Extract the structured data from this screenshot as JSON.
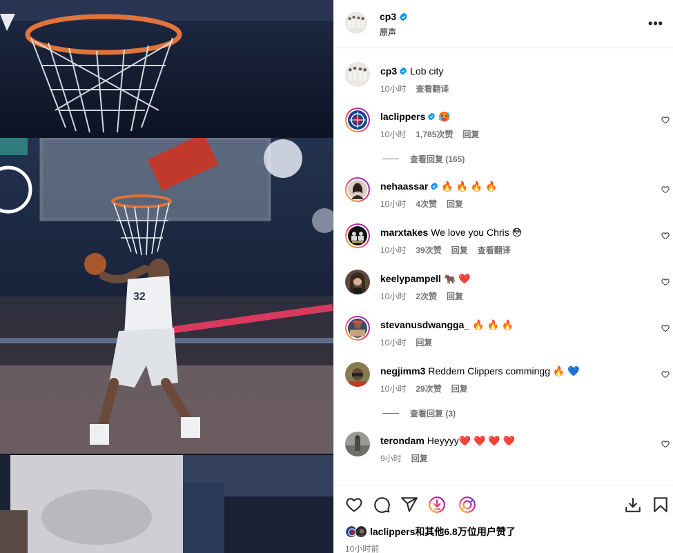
{
  "post": {
    "username": "cp3",
    "audio": "原声",
    "more": "•••"
  },
  "caption": {
    "username": "cp3",
    "text": "Lob city",
    "time": "10小时",
    "translate": "查看翻译"
  },
  "comments": [
    {
      "username": "laclippers",
      "verified": true,
      "text": "🥵",
      "time": "10小时",
      "likes": "1,785次赞",
      "reply": "回复",
      "view_replies": "查看回复 (165)"
    },
    {
      "username": "nehaassar",
      "verified": true,
      "text": "🔥 🔥 🔥 🔥",
      "time": "10小时",
      "likes": "4次赞",
      "reply": "回复"
    },
    {
      "username": "marxtakes",
      "verified": false,
      "text": "We love you Chris 😳",
      "time": "10小时",
      "likes": "39次赞",
      "reply": "回复",
      "translate": "查看翻译"
    },
    {
      "username": "keelypampell",
      "verified": false,
      "text": "🐂 ❤️",
      "time": "10小时",
      "likes": "2次赞",
      "reply": "回复"
    },
    {
      "username": "stevanusdwangga_",
      "verified": false,
      "text": "🔥 🔥 🔥",
      "time": "10小时",
      "reply": "回复"
    },
    {
      "username": "negjimm3",
      "verified": false,
      "text": "Reddem Clippers commingg 🔥 💙",
      "time": "10小时",
      "likes": "29次赞",
      "reply": "回复",
      "view_replies": "查看回复 (3)"
    },
    {
      "username": "terondam",
      "verified": false,
      "text": "Heyyyy❤️ ❤️ ❤️ ❤️",
      "time": "9小时",
      "reply": "回复"
    }
  ],
  "likes": {
    "username": "laclippers",
    "rest": "和其他6.8万位用户赞了"
  },
  "posted": "10小时前",
  "icons": {
    "like": "heart-icon",
    "comment": "comment-icon",
    "share": "share-icon",
    "repost": "repost-icon",
    "remix": "remix-icon",
    "download": "download-icon",
    "save": "bookmark-icon",
    "verified": "verified-badge-icon"
  },
  "colors": {
    "verified": "#0095f6",
    "muted": "#737373",
    "divider": "#efefef",
    "gradient_start": "#f9ce34",
    "gradient_mid": "#ee2a7b",
    "gradient_end": "#6228d7"
  }
}
